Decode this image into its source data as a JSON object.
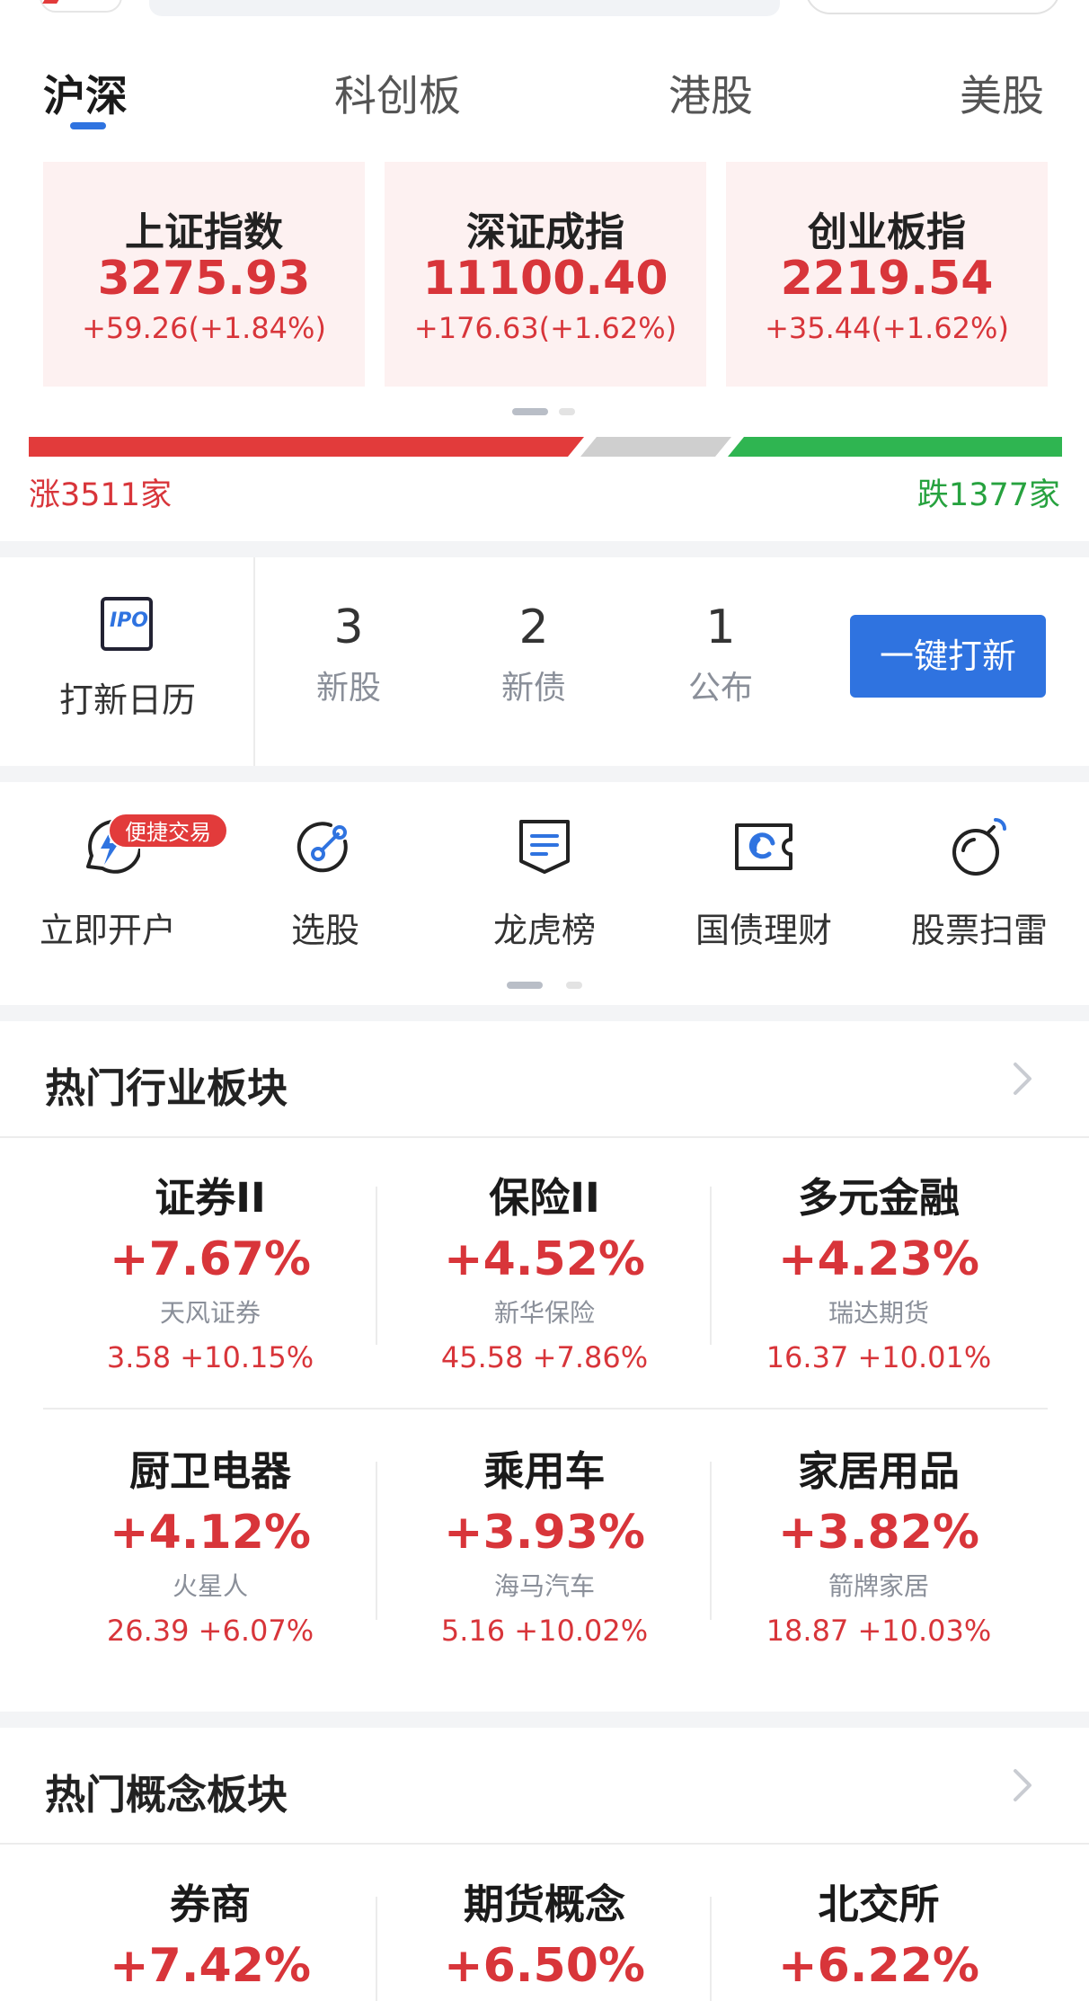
{
  "market_tabs": [
    {
      "label": "沪深",
      "active": true
    },
    {
      "label": "科创板",
      "active": false
    },
    {
      "label": "港股",
      "active": false
    },
    {
      "label": "美股",
      "active": false
    }
  ],
  "indices": [
    {
      "name": "上证指数",
      "value": "3275.93",
      "change": "+59.26(+1.84%)"
    },
    {
      "name": "深证成指",
      "value": "11100.40",
      "change": "+176.63(+1.62%)"
    },
    {
      "name": "创业板指",
      "value": "2219.54",
      "change": "+35.44(+1.62%)"
    }
  ],
  "breadth": {
    "rise_label": "涨3511家",
    "fall_label": "跌1377家",
    "rise_color": "#e23b3b",
    "flat_color": "#cfcfcf",
    "fall_color": "#2fb551"
  },
  "ipo": {
    "calendar_label": "打新日历",
    "icon_text": "IPO",
    "stats": [
      {
        "count": "3",
        "label": "新股"
      },
      {
        "count": "2",
        "label": "新债"
      },
      {
        "count": "1",
        "label": "公布"
      }
    ],
    "button_label": "一键打新"
  },
  "tools": {
    "badge": "便捷交易",
    "items": [
      {
        "label": "立即开户",
        "icon": "lightning-chat-icon"
      },
      {
        "label": "选股",
        "icon": "stock-picker-icon"
      },
      {
        "label": "龙虎榜",
        "icon": "document-list-icon"
      },
      {
        "label": "国债理财",
        "icon": "bond-ticket-icon"
      },
      {
        "label": "股票扫雷",
        "icon": "bomb-icon"
      }
    ]
  },
  "hot_industry": {
    "title": "热门行业板块",
    "items": [
      {
        "sector": "证券II",
        "pct": "+7.67%",
        "stock": "天风证券",
        "quote": "3.58  +10.15%"
      },
      {
        "sector": "保险II",
        "pct": "+4.52%",
        "stock": "新华保险",
        "quote": "45.58  +7.86%"
      },
      {
        "sector": "多元金融",
        "pct": "+4.23%",
        "stock": "瑞达期货",
        "quote": "16.37  +10.01%"
      },
      {
        "sector": "厨卫电器",
        "pct": "+4.12%",
        "stock": "火星人",
        "quote": "26.39  +6.07%"
      },
      {
        "sector": "乘用车",
        "pct": "+3.93%",
        "stock": "海马汽车",
        "quote": "5.16  +10.02%"
      },
      {
        "sector": "家居用品",
        "pct": "+3.82%",
        "stock": "箭牌家居",
        "quote": "18.87  +10.03%"
      }
    ]
  },
  "hot_concept": {
    "title": "热门概念板块",
    "items": [
      {
        "sector": "券商",
        "pct": "+7.42%"
      },
      {
        "sector": "期货概念",
        "pct": "+6.50%"
      },
      {
        "sector": "北交所",
        "pct": "+6.22%"
      }
    ]
  },
  "colors": {
    "accent": "#2f73e0",
    "up": "#d8353a",
    "down": "#27a23f",
    "card_bg": "#fdf1f1"
  }
}
